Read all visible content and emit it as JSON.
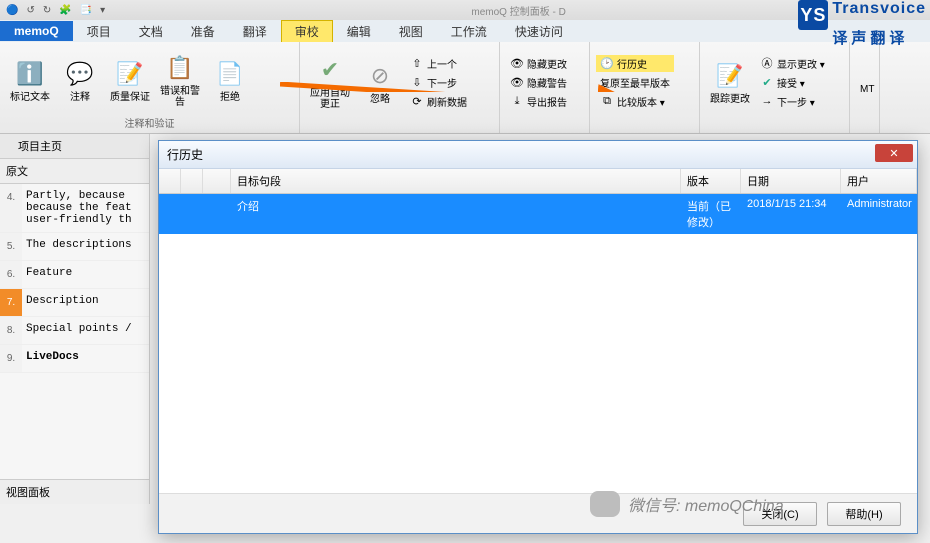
{
  "window_title": "memoQ 控制面板 - D",
  "menu": {
    "brand": "memoQ",
    "items": [
      "项目",
      "文档",
      "准备",
      "翻译",
      "审校",
      "编辑",
      "视图",
      "工作流",
      "快速访问"
    ],
    "active_index": 4
  },
  "ribbon": {
    "group1": {
      "label": "注释和验证",
      "btns": [
        {
          "icon": "ℹ️",
          "text": "标记文本"
        },
        {
          "icon": "💬",
          "text": "注释"
        },
        {
          "icon": "✅",
          "text": "质量保证"
        },
        {
          "icon": "📋",
          "text": "错误和警告"
        },
        {
          "icon": "📄",
          "text": "拒绝"
        }
      ]
    },
    "group2": {
      "btns": [
        {
          "icon": "✔",
          "text": "应用自动更正"
        },
        {
          "icon": "⊘",
          "text": "忽略"
        }
      ],
      "small": [
        "上一个",
        "下一步",
        "刷新数据"
      ]
    },
    "group3_small": [
      "隐藏更改",
      "隐藏警告",
      "导出报告"
    ],
    "group4": {
      "hist": "行历史",
      "a": "复原至最早版本",
      "b": "比较版本 ▾"
    },
    "group5": {
      "big": "跟踪更改",
      "small": [
        "显示更改 ▾",
        "接受 ▾",
        "下一步 ▾"
      ],
      "mt": "MT"
    }
  },
  "left": {
    "home": "项目主页",
    "src_label": "原文",
    "segs": [
      {
        "n": "4.",
        "t": "Partly, because because the feat user-friendly th"
      },
      {
        "n": "5.",
        "t": "The descriptions"
      },
      {
        "n": "6.",
        "t": "Feature"
      },
      {
        "n": "7.",
        "t": "Description"
      },
      {
        "n": "8.",
        "t": "Special points /"
      },
      {
        "n": "9.",
        "t": "LiveDocs"
      }
    ],
    "current_index": 3,
    "view_panel": "视图面板"
  },
  "dialog": {
    "title": "行历史",
    "cols": {
      "target": "目标句段",
      "ver": "版本",
      "date": "日期",
      "user": "用户"
    },
    "row": {
      "target": "介绍",
      "ver": "当前（已修改）",
      "date": "2018/1/15 21:34",
      "user": "Administrator"
    },
    "close_btn": "关闭(C)",
    "help_btn": "帮助(H)"
  },
  "logo": {
    "top": "Transvoice",
    "bottom": "译声翻译"
  },
  "wechat": "微信号: memoQChina"
}
